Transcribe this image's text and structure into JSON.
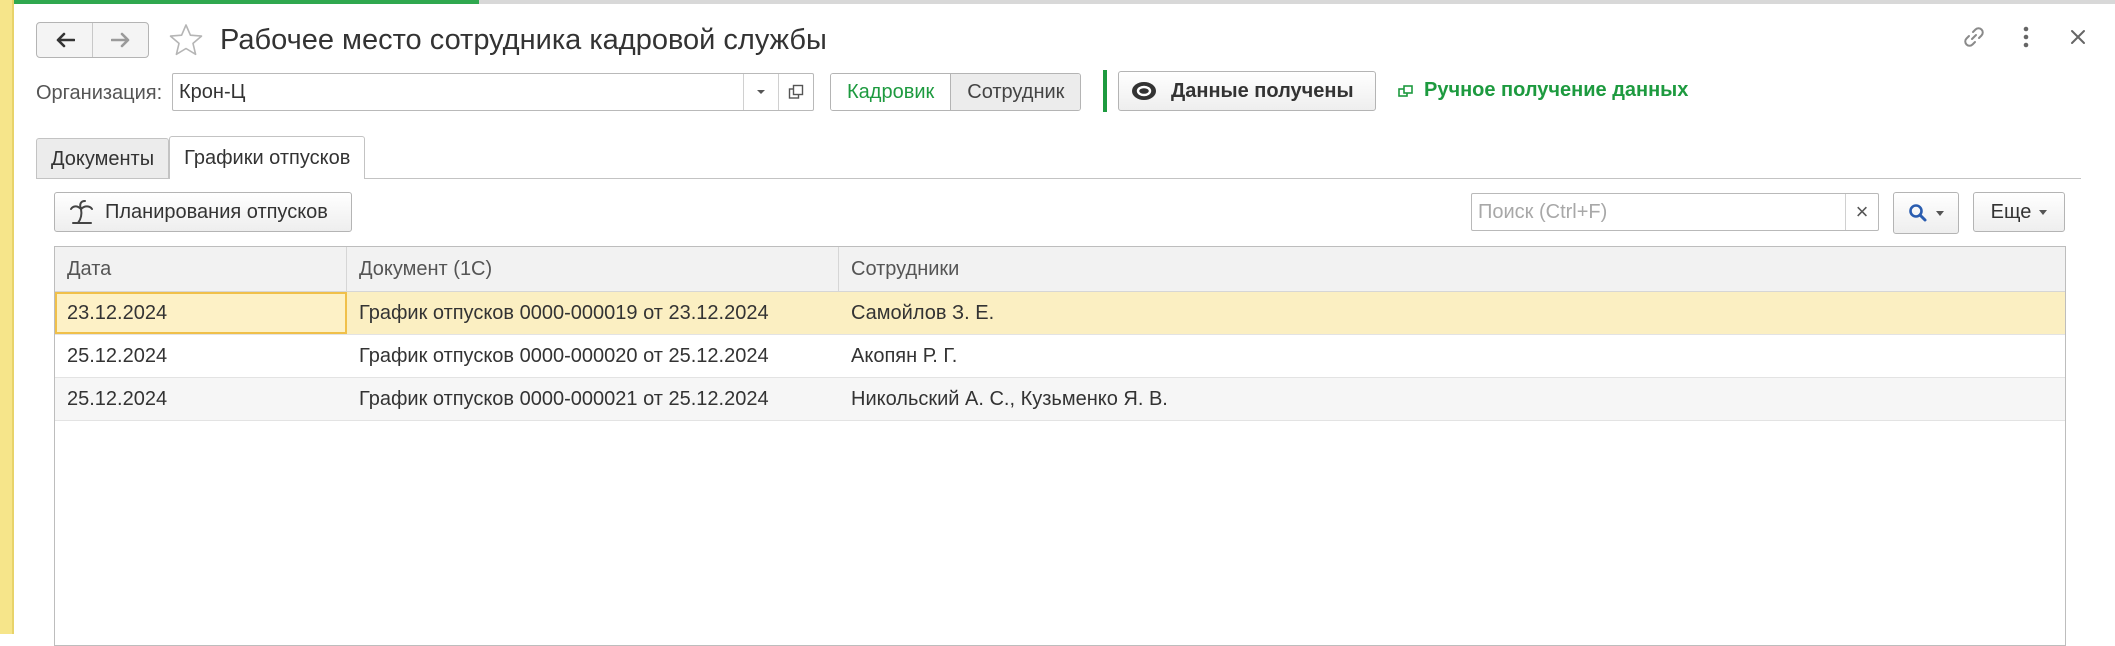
{
  "window": {
    "title": "Рабочее место сотрудника кадровой службы"
  },
  "organization": {
    "label": "Организация:",
    "value": "Крон-Ц"
  },
  "mode_switch": {
    "options": [
      "Кадровик",
      "Сотрудник"
    ],
    "selected": "Кадровик"
  },
  "status": {
    "data_received_label": "Данные получены",
    "manual_link_label": "Ручное получение данных"
  },
  "tabs": [
    {
      "label": "Документы",
      "active": false
    },
    {
      "label": "Графики отпусков",
      "active": true
    }
  ],
  "toolbar": {
    "plan_button_label": "Планирования отпусков",
    "search_placeholder": "Поиск (Ctrl+F)",
    "search_clear_symbol": "×",
    "more_label": "Еще"
  },
  "table": {
    "columns": [
      "Дата",
      "Документ (1С)",
      "Сотрудники"
    ],
    "rows": [
      {
        "date": "23.12.2024",
        "document": "График отпусков 0000-000019 от 23.12.2024",
        "employees": "Самойлов З. Е.",
        "selected": true
      },
      {
        "date": "25.12.2024",
        "document": "График отпусков 0000-000020 от 25.12.2024",
        "employees": "Акопян Р. Г.",
        "selected": false
      },
      {
        "date": "25.12.2024",
        "document": "График отпусков 0000-000021 от 25.12.2024",
        "employees": "Никольский А. С., Кузьменко Я. В.",
        "selected": false
      }
    ]
  },
  "colors": {
    "accent_green": "#1d9a3f",
    "selected_row": "#fbefc2",
    "left_strip": "#f6e58a"
  },
  "icons": {
    "back": "arrow-left-icon",
    "forward": "arrow-right-icon",
    "favorite": "star-icon",
    "link": "link-icon",
    "menu": "more-vertical-icon",
    "close": "close-icon",
    "dropdown": "chevron-down-icon",
    "open": "open-in-window-icon",
    "data": "sync-status-icon",
    "manual": "external-link-icon",
    "plan": "palm-tree-icon",
    "search": "search-icon"
  }
}
